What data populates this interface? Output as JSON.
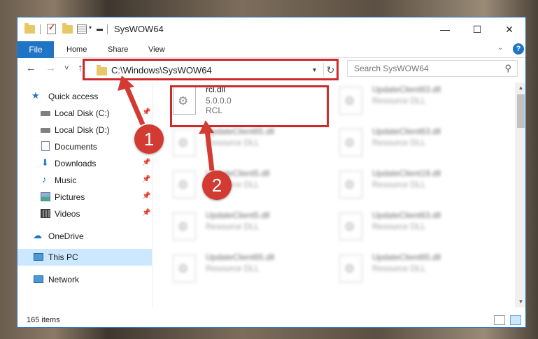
{
  "window": {
    "title": "SysWOW64",
    "controls": {
      "minimize": "—",
      "maximize": "☐",
      "close": "✕"
    }
  },
  "ribbon": {
    "tabs": [
      "File",
      "Home",
      "Share",
      "View"
    ],
    "help": "?"
  },
  "navigation": {
    "back": "←",
    "forward": "→",
    "recent": "˅",
    "up": "↑",
    "address": "C:\\Windows\\SysWOW64",
    "refresh": "↻",
    "search_placeholder": "Search SysWOW64"
  },
  "sidebar": {
    "items": [
      {
        "label": "Quick access",
        "icon": "star-icon",
        "pinned": false
      },
      {
        "label": "Local Disk (C:)",
        "icon": "drive-icon",
        "pinned": true
      },
      {
        "label": "Local Disk (D:)",
        "icon": "drive-icon",
        "pinned": false
      },
      {
        "label": "Documents",
        "icon": "documents-icon",
        "pinned": true
      },
      {
        "label": "Downloads",
        "icon": "download-icon",
        "pinned": true
      },
      {
        "label": "Music",
        "icon": "music-icon",
        "pinned": true
      },
      {
        "label": "Pictures",
        "icon": "pictures-icon",
        "pinned": true
      },
      {
        "label": "Videos",
        "icon": "videos-icon",
        "pinned": true
      },
      {
        "label": "OneDrive",
        "icon": "cloud-icon",
        "pinned": false
      },
      {
        "label": "This PC",
        "icon": "computer-icon",
        "pinned": false,
        "selected": true
      },
      {
        "label": "Network",
        "icon": "network-icon",
        "pinned": false
      }
    ]
  },
  "files": {
    "highlighted": {
      "name": "rcl.dll",
      "version": "5.0.0.0",
      "description": "RCL"
    },
    "left_column": [
      {
        "name": "UpdateClient65.dll",
        "description": "Resource DLL"
      },
      {
        "name": "UpdateClient5.dll",
        "description": "Resource DLL"
      },
      {
        "name": "UpdateClient5.dll",
        "description": "Resource DLL"
      },
      {
        "name": "UpdateClient65.dll",
        "description": "Resource DLL"
      }
    ],
    "right_column": [
      {
        "name": "UpdateClient63.dll",
        "description": "Resource DLL"
      },
      {
        "name": "UpdateClient63.dll",
        "description": "Resource DLL"
      },
      {
        "name": "UpdateClient19.dll",
        "description": "Resource DLL"
      },
      {
        "name": "UpdateClient63.dll",
        "description": "Resource DLL"
      },
      {
        "name": "UpdateClient65.dll",
        "description": "Resource DLL"
      }
    ]
  },
  "status": {
    "item_count": "165 items"
  },
  "annotations": {
    "badge_1": "1",
    "badge_2": "2",
    "highlight_color": "#cc2b2b"
  },
  "colors": {
    "accent": "#1f74c6",
    "selection": "#cce8ff"
  }
}
